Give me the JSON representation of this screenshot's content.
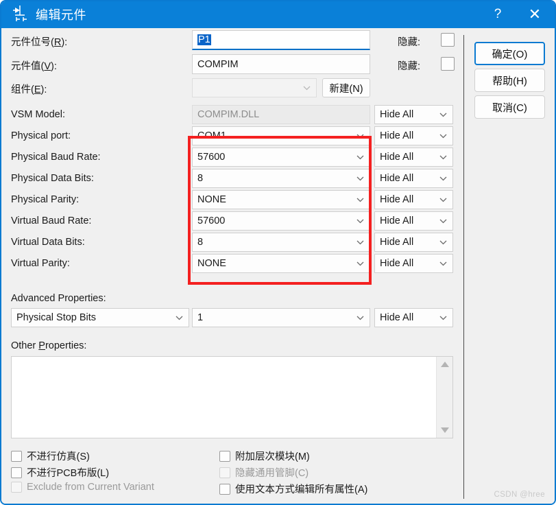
{
  "window": {
    "title": "编辑元件",
    "icon": "component-circuit-icon",
    "help_glyph": "?",
    "close_glyph": "✕",
    "accent_color": "#0a80d8",
    "highlight_color": "#f42020"
  },
  "form": {
    "reference": {
      "label": "元件位号(R):",
      "mnemonic": "R",
      "value": "P1",
      "selected": true,
      "hide_label": "隐藏:",
      "hide_checked": false
    },
    "value": {
      "label": "元件值(V):",
      "mnemonic": "V",
      "value": "COMPIM",
      "hide_label": "隐藏:",
      "hide_checked": false
    },
    "element": {
      "label": "组件(E):",
      "mnemonic": "E",
      "value": "",
      "new_button": "新建(N)"
    },
    "rows": [
      {
        "label": "VSM Model:",
        "value": "COMPIM.DLL",
        "kind": "disabled",
        "hide": "Hide All"
      },
      {
        "label": "Physical port:",
        "value": "COM1",
        "kind": "combo",
        "hide": "Hide All"
      },
      {
        "label": "Physical Baud Rate:",
        "value": "57600",
        "kind": "combo",
        "hide": "Hide All"
      },
      {
        "label": "Physical Data Bits:",
        "value": "8",
        "kind": "combo",
        "hide": "Hide All"
      },
      {
        "label": "Physical Parity:",
        "value": "NONE",
        "kind": "combo",
        "hide": "Hide All"
      },
      {
        "label": "Virtual Baud Rate:",
        "value": "57600",
        "kind": "combo",
        "hide": "Hide All"
      },
      {
        "label": "Virtual Data Bits:",
        "value": "8",
        "kind": "combo",
        "hide": "Hide All"
      },
      {
        "label": "Virtual Parity:",
        "value": "NONE",
        "kind": "combo",
        "hide": "Hide All"
      }
    ],
    "advanced": {
      "label": "Advanced Properties:",
      "property": "Physical Stop Bits",
      "value": "1",
      "hide": "Hide All"
    },
    "other": {
      "label": "Other Properties:",
      "mnemonic": "P",
      "value": ""
    }
  },
  "checkboxes": {
    "left": [
      {
        "label": "不进行仿真(S)",
        "checked": false,
        "disabled": false
      },
      {
        "label": "不进行PCB布版(L)",
        "checked": false,
        "disabled": false
      },
      {
        "label": "Exclude from Current Variant",
        "checked": false,
        "disabled": true
      }
    ],
    "right": [
      {
        "label": "附加层次模块(M)",
        "checked": false,
        "disabled": false
      },
      {
        "label": "隐藏通用管脚(C)",
        "checked": false,
        "disabled": true
      },
      {
        "label": "使用文本方式编辑所有属性(A)",
        "checked": false,
        "disabled": false
      }
    ]
  },
  "buttons": {
    "ok": "确定(O)",
    "help": "帮助(H)",
    "cancel": "取消(C)"
  },
  "watermark": "CSDN @hree"
}
